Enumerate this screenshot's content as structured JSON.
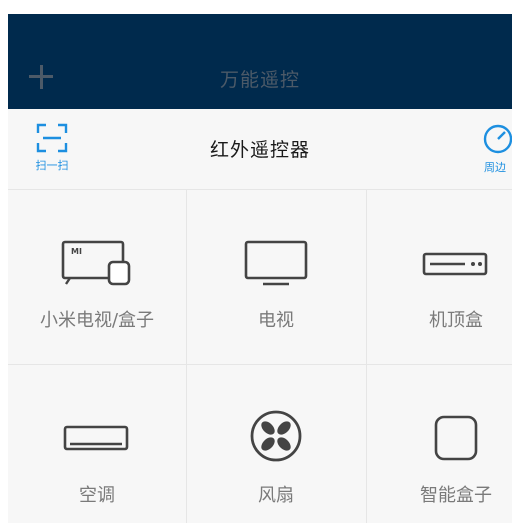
{
  "header": {
    "title": "万能遥控",
    "bg_color": "#002a4d"
  },
  "subheader": {
    "title": "红外遥控器",
    "scan_label": "扫一扫",
    "nearby_label": "周边",
    "accent_color": "#1d8fe0"
  },
  "devices": [
    {
      "label": "小米电视/盒子",
      "icon": "mi-tv-box-icon"
    },
    {
      "label": "电视",
      "icon": "tv-icon"
    },
    {
      "label": "机顶盒",
      "icon": "set-top-box-icon"
    },
    {
      "label": "空调",
      "icon": "air-conditioner-icon"
    },
    {
      "label": "风扇",
      "icon": "fan-icon"
    },
    {
      "label": "智能盒子",
      "icon": "smart-box-icon"
    }
  ]
}
